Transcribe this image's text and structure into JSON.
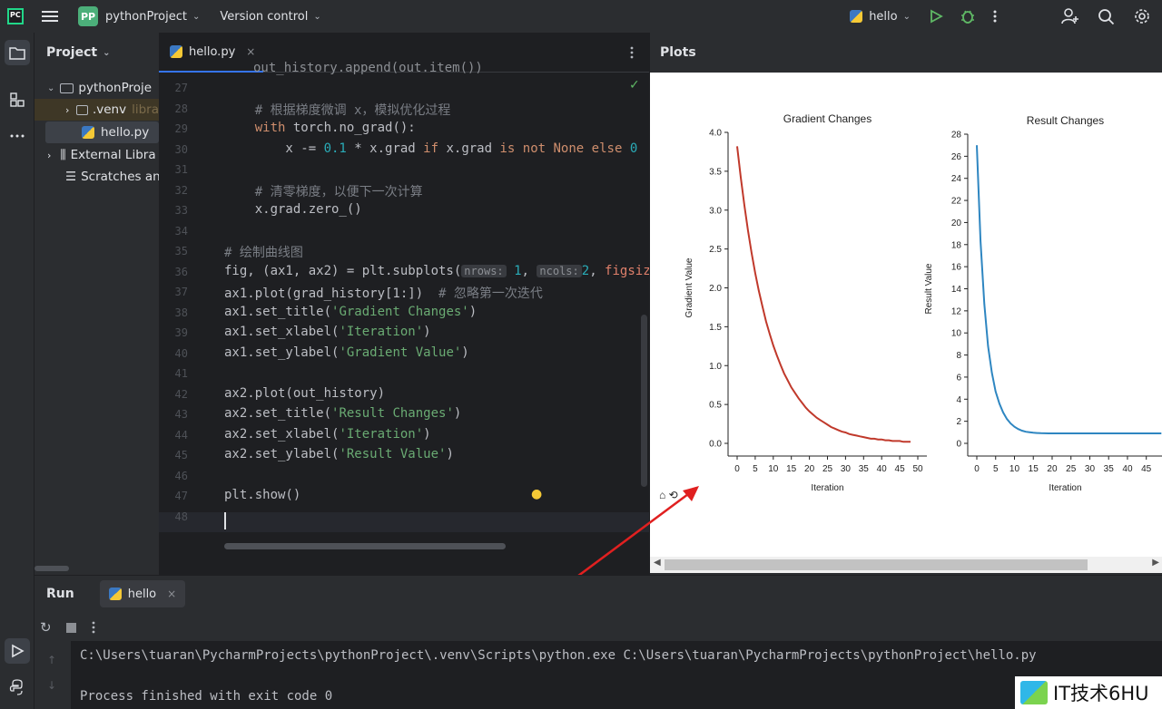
{
  "titlebar": {
    "project_badge": "PP",
    "project_name": "pythonProject",
    "vcs_label": "Version control",
    "run_config": "hello"
  },
  "project_panel": {
    "title": "Project",
    "tree": [
      {
        "label": "pythonProje",
        "type": "folder"
      },
      {
        "label": ".venv",
        "extra": "libra",
        "type": "folder"
      },
      {
        "label": "hello.py",
        "type": "file"
      },
      {
        "label": "External Libra",
        "type": "library"
      },
      {
        "label": "Scratches an",
        "type": "scratch"
      }
    ]
  },
  "editor": {
    "tab_label": "hello.py",
    "top_partial": "out_history.append(out.item())",
    "lines": [
      {
        "n": "27",
        "code": ""
      },
      {
        "n": "28",
        "code": "    # 根据梯度微调 x，模拟优化过程"
      },
      {
        "n": "29",
        "code": "    with torch.no_grad():"
      },
      {
        "n": "30",
        "code": "        x -= 0.1 * x.grad if x.grad is not None else 0  #"
      },
      {
        "n": "31",
        "code": ""
      },
      {
        "n": "32",
        "code": "    # 清零梯度，以便下一次计算"
      },
      {
        "n": "33",
        "code": "    x.grad.zero_()"
      },
      {
        "n": "34",
        "code": ""
      },
      {
        "n": "35",
        "code": "# 绘制曲线图"
      },
      {
        "n": "36",
        "code": "fig, (ax1, ax2) = plt.subplots("
      },
      {
        "n": "37",
        "code": "ax1.plot(grad_history[1:])"
      },
      {
        "n": "38",
        "code": "ax1.set_title('Gradient Changes')"
      },
      {
        "n": "39",
        "code": "ax1.set_xlabel('Iteration')"
      },
      {
        "n": "40",
        "code": "ax1.set_ylabel('Gradient Value')"
      },
      {
        "n": "41",
        "code": ""
      },
      {
        "n": "42",
        "code": "ax2.plot(out_history)"
      },
      {
        "n": "43",
        "code": "ax2.set_title('Result Changes')"
      },
      {
        "n": "44",
        "code": "ax2.set_xlabel('Iteration')"
      },
      {
        "n": "45",
        "code": "ax2.set_ylabel('Result Value')"
      },
      {
        "n": "46",
        "code": ""
      },
      {
        "n": "47",
        "code": "plt.show()"
      },
      {
        "n": "48",
        "code": ""
      }
    ],
    "hint_nrows": "nrows:",
    "hint_ncols": "ncols:",
    "hint_figsize": "figsize",
    "comment_37": "# 忽略第一次迭代"
  },
  "plots_panel": {
    "title": "Plots"
  },
  "chart_data": [
    {
      "type": "line",
      "title": "Gradient Changes",
      "xlabel": "Iteration",
      "ylabel": "Gradient Value",
      "xlim": [
        0,
        50
      ],
      "ylim": [
        0,
        4.0
      ],
      "xticks": [
        "0",
        "5",
        "10",
        "15",
        "20",
        "25",
        "30",
        "35",
        "40",
        "45",
        "50"
      ],
      "yticks": [
        "0.0",
        "0.5",
        "1.0",
        "1.5",
        "2.0",
        "2.5",
        "3.0",
        "3.5",
        "4.0"
      ],
      "color": "#c0392b",
      "x": [
        0,
        1,
        2,
        3,
        4,
        5,
        6,
        7,
        8,
        9,
        10,
        11,
        12,
        13,
        14,
        15,
        16,
        17,
        18,
        19,
        20,
        21,
        22,
        23,
        24,
        25,
        26,
        27,
        28,
        29,
        30,
        31,
        32,
        33,
        34,
        35,
        36,
        37,
        38,
        39,
        40,
        41,
        42,
        43,
        44,
        45,
        46,
        47,
        48
      ],
      "values": [
        3.82,
        3.42,
        3.06,
        2.74,
        2.45,
        2.19,
        1.96,
        1.76,
        1.57,
        1.41,
        1.26,
        1.13,
        1.01,
        0.9,
        0.81,
        0.72,
        0.65,
        0.58,
        0.52,
        0.46,
        0.41,
        0.37,
        0.33,
        0.3,
        0.27,
        0.24,
        0.21,
        0.19,
        0.17,
        0.15,
        0.14,
        0.12,
        0.11,
        0.1,
        0.09,
        0.08,
        0.07,
        0.06,
        0.06,
        0.05,
        0.05,
        0.04,
        0.04,
        0.03,
        0.03,
        0.03,
        0.02,
        0.02,
        0.02
      ]
    },
    {
      "type": "line",
      "title": "Result Changes",
      "xlabel": "Iteration",
      "ylabel": "Result Value",
      "xlim": [
        0,
        47
      ],
      "ylim": [
        0,
        28
      ],
      "xticks": [
        "0",
        "5",
        "10",
        "15",
        "20",
        "25",
        "30",
        "35",
        "40",
        "45"
      ],
      "yticks": [
        "0",
        "2",
        "4",
        "6",
        "8",
        "10",
        "12",
        "14",
        "16",
        "18",
        "20",
        "22",
        "24",
        "26",
        "28"
      ],
      "color": "#2e86c1",
      "x": [
        0,
        1,
        2,
        3,
        4,
        5,
        6,
        7,
        8,
        9,
        10,
        11,
        12,
        13,
        14,
        15,
        16,
        17,
        18,
        19,
        20,
        21,
        22,
        23,
        24,
        25,
        26,
        27,
        28,
        29,
        30,
        31,
        32,
        33,
        34,
        35,
        36,
        37,
        38,
        39,
        40,
        41,
        42,
        43,
        44,
        45,
        46,
        47,
        48,
        49
      ],
      "values": [
        27,
        18.3,
        12.6,
        8.8,
        6.4,
        4.7,
        3.6,
        2.8,
        2.2,
        1.8,
        1.5,
        1.3,
        1.15,
        1.05,
        1.0,
        0.96,
        0.94,
        0.92,
        0.91,
        0.9,
        0.9,
        0.9,
        0.9,
        0.9,
        0.9,
        0.9,
        0.9,
        0.9,
        0.9,
        0.9,
        0.9,
        0.9,
        0.9,
        0.9,
        0.9,
        0.9,
        0.9,
        0.9,
        0.9,
        0.9,
        0.9,
        0.9,
        0.9,
        0.9,
        0.9,
        0.9,
        0.9,
        0.9,
        0.9,
        0.9
      ]
    }
  ],
  "run_panel": {
    "tab_run": "Run",
    "tab_config": "hello",
    "console_line1": "C:\\Users\\tuaran\\PycharmProjects\\pythonProject\\.venv\\Scripts\\python.exe C:\\Users\\tuaran\\PycharmProjects\\pythonProject\\hello.py",
    "console_line2": "Process finished with exit code 0"
  },
  "watermark": {
    "text": "IT技术6HU"
  },
  "colors": {
    "accent": "#3574f0",
    "run_green": "#5fb865",
    "arrow_red": "#e02020"
  }
}
